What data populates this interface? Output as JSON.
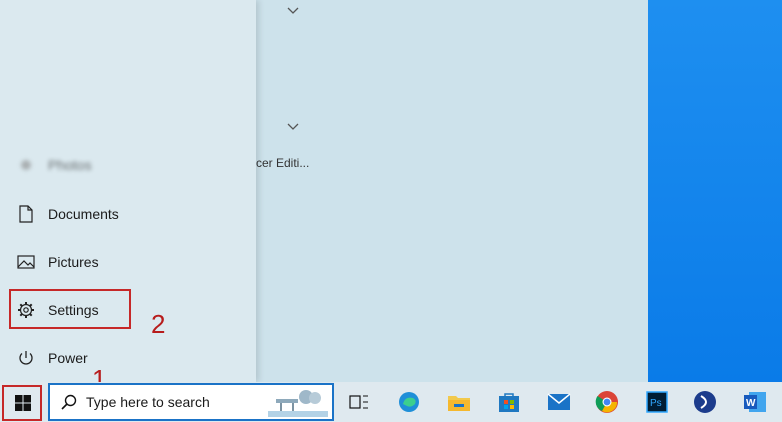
{
  "start_menu": {
    "items": [
      {
        "id": "photos",
        "label": "Photos",
        "icon": "image-icon"
      },
      {
        "id": "documents",
        "label": "Documents",
        "icon": "document-icon"
      },
      {
        "id": "pictures",
        "label": "Pictures",
        "icon": "pictures-icon"
      },
      {
        "id": "settings",
        "label": "Settings",
        "icon": "gear-icon"
      },
      {
        "id": "power",
        "label": "Power",
        "icon": "power-icon"
      }
    ],
    "tile_partial_text": "cer Editi..."
  },
  "annotations": {
    "step1": "1",
    "step2": "2",
    "highlight_color": "#c62828"
  },
  "taskbar": {
    "search_placeholder": "Type here to search",
    "icons": [
      "windows-start-icon",
      "search-icon",
      "task-view-icon",
      "edge-icon",
      "file-explorer-icon",
      "microsoft-store-icon",
      "mail-icon",
      "chrome-icon",
      "photoshop-icon",
      "generic-app-icon",
      "word-icon"
    ]
  },
  "colors": {
    "accent": "#1a73c7",
    "desktop": "#0a7be8"
  }
}
